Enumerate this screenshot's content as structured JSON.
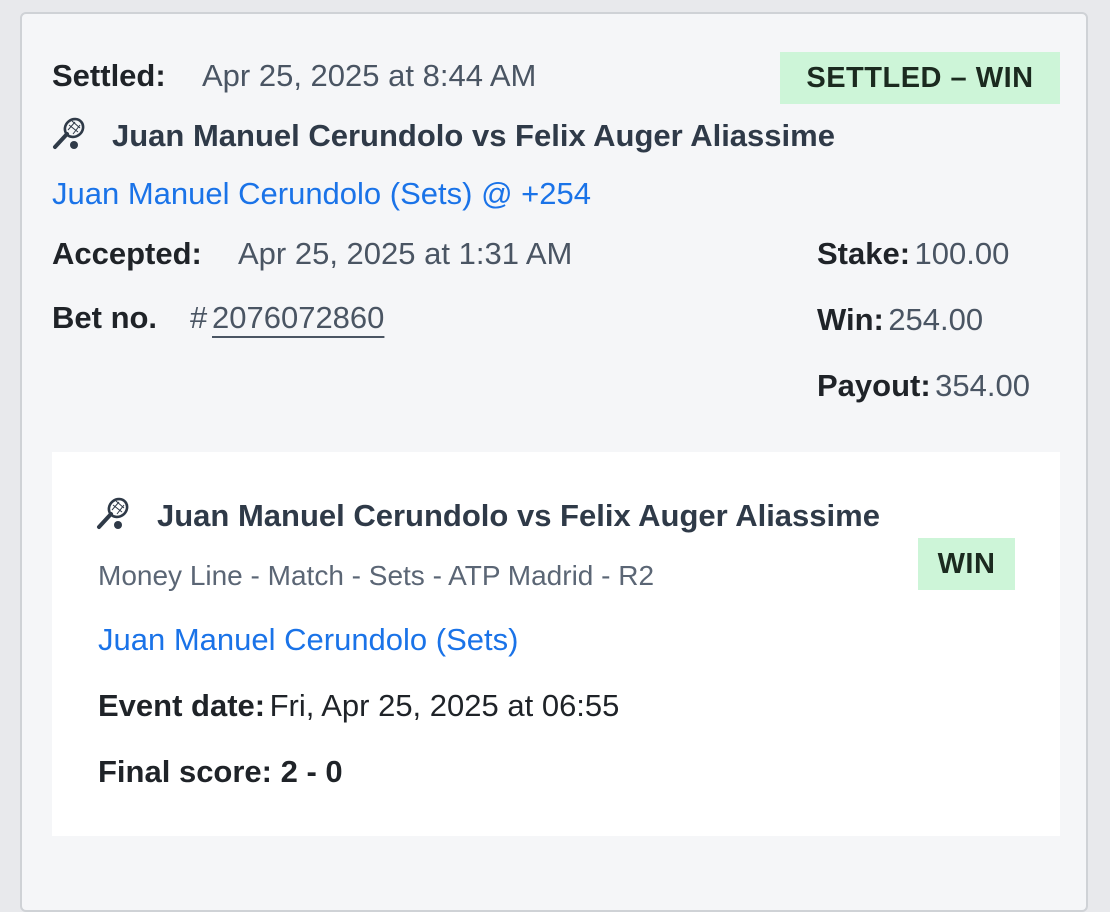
{
  "header": {
    "settled_label": "Settled:",
    "settled_value": "Apr 25, 2025 at 8:44 AM",
    "status_badge": "SETTLED – WIN"
  },
  "bet": {
    "sport_icon": "tennis-racket-icon",
    "event_title": "Juan Manuel Cerundolo vs Felix Auger Aliassime",
    "selection": "Juan Manuel Cerundolo (Sets)",
    "odds": "@ +254",
    "accepted_label": "Accepted:",
    "accepted_value": "Apr 25, 2025 at 1:31 AM",
    "betno_label": "Bet no.",
    "betno_hash": "#",
    "betno_value": "2076072860",
    "stake_label": "Stake:",
    "stake_value": "100.00",
    "win_label": "Win:",
    "win_value": "254.00",
    "payout_label": "Payout:",
    "payout_value": "354.00"
  },
  "leg": {
    "sport_icon": "tennis-racket-icon",
    "event_title": "Juan Manuel Cerundolo vs Felix Auger Aliassime",
    "market": "Money Line - Match - Sets - ATP Madrid - R2",
    "result_badge": "WIN",
    "selection": "Juan Manuel Cerundolo (Sets)",
    "event_date_label": "Event date:",
    "event_date_value": "Fri, Apr 25, 2025 at 06:55",
    "final_score": "Final score: 2 - 0"
  },
  "colors": {
    "accent_link": "#1a73e8",
    "win_badge_bg": "#cdf5d8",
    "card_bg": "#f5f6f8"
  }
}
